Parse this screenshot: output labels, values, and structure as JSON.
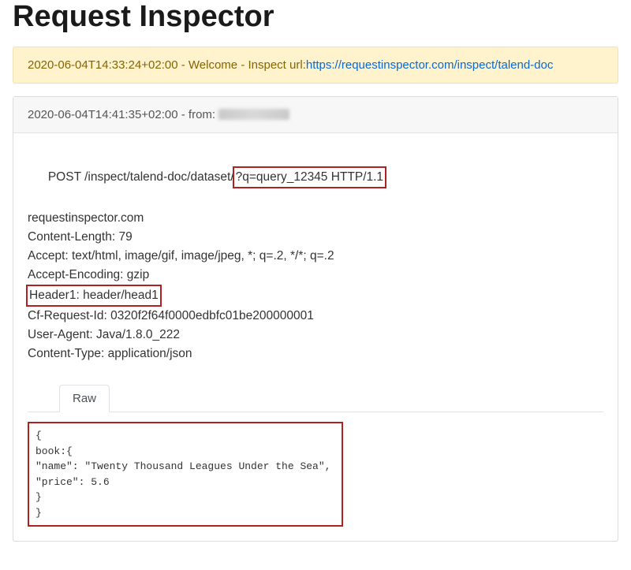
{
  "title": "Request Inspector",
  "welcome": {
    "ts": "2020-06-04T14:33:24+02:00",
    "prefix": " - Welcome - Inspect url:",
    "url": "https://requestinspector.com/inspect/talend-doc"
  },
  "request": {
    "header_ts": "2020-06-04T14:41:35+02:00",
    "header_sep": " - from: ",
    "reqline_pre": "POST /inspect/talend-doc/dataset/",
    "reqline_hi": "?q=query_12345 HTTP/1.1",
    "headers": [
      "requestinspector.com",
      "Content-Length: 79",
      "Accept: text/html, image/gif, image/jpeg, *; q=.2, */*; q=.2",
      "Accept-Encoding: gzip"
    ],
    "header_hi": "Header1: header/head1",
    "headers2": [
      "Cf-Request-Id: 0320f2f64f0000edbfc01be200000001",
      "User-Agent: Java/1.8.0_222",
      "Content-Type: application/json"
    ]
  },
  "tabs": {
    "raw": "Raw"
  },
  "body": {
    "lines": [
      "{",
      "book:{",
      "\"name\": \"Twenty Thousand Leagues Under the Sea\",",
      "\"price\": 5.6",
      "}",
      "}"
    ]
  }
}
